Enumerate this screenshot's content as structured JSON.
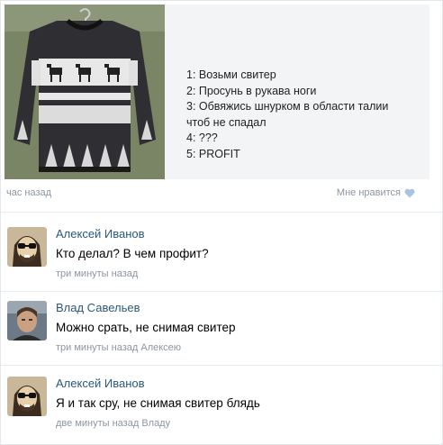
{
  "post": {
    "caption": [
      "1: Возьми свитер",
      "2: Просунь в рукава ноги",
      "3: Обвяжись шнурком в области талии",
      "чтоб не спадал",
      "4: ???",
      "5: PROFIT"
    ],
    "time": "час назад",
    "like_label": "Мне нравится",
    "image_icon": "sweater-photo"
  },
  "comments": [
    {
      "author": "Алексей Иванов",
      "text": "Кто делал? В чем профит?",
      "time": "три минуты назад",
      "reply_to": ""
    },
    {
      "author": "Влад Савельев",
      "text": "Можно срать, не снимая свитер",
      "time": "три минуты назад",
      "reply_to": "Алексею"
    },
    {
      "author": "Алексей Иванов",
      "text": "Я и так сру, не снимая свитер блядь",
      "time": "две минуты назад",
      "reply_to": "Владу"
    }
  ],
  "colors": {
    "link": "#2b587a",
    "meta": "#8b96a3",
    "heart": "#a9c3e0"
  }
}
